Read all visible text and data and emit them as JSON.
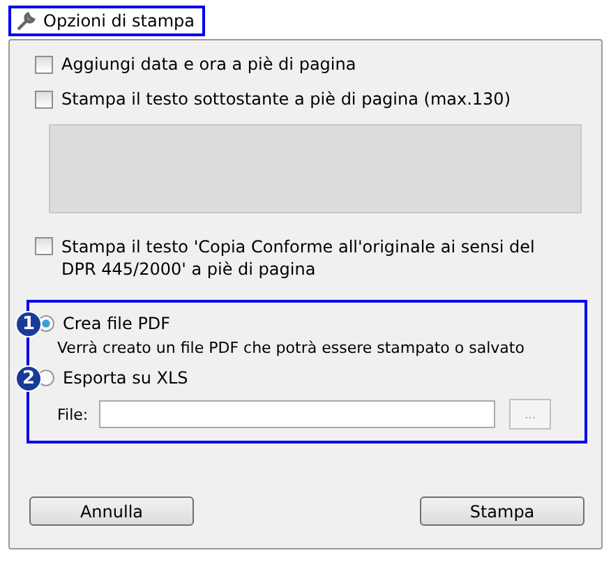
{
  "window": {
    "title": "Opzioni di stampa"
  },
  "options": [
    {
      "label": "Aggiungi data e ora a piè di pagina",
      "checked": false
    },
    {
      "label": "Stampa il testo sottostante a piè di pagina (max.130)",
      "checked": false
    }
  ],
  "footer_text": {
    "disabled": true
  },
  "conform_option": {
    "label": "Stampa il testo 'Copia Conforme all'originale ai sensi del DPR 445/2000' a piè di pagina",
    "checked": false
  },
  "output": [
    {
      "marker": "1",
      "label": "Crea file PDF",
      "selected": true,
      "description": "Verrà creato un file PDF che potrà essere stampato o salvato"
    },
    {
      "marker": "2",
      "label": "Esporta su XLS",
      "selected": false
    }
  ],
  "file": {
    "label": "File:",
    "browse": "..."
  },
  "buttons": [
    "Annulla",
    "Stampa"
  ]
}
